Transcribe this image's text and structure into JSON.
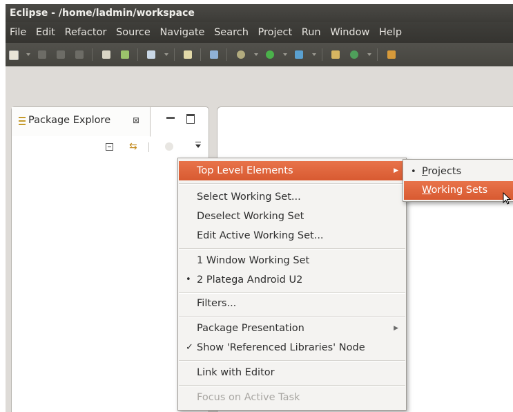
{
  "window": {
    "title": "Eclipse - /home/ladmin/workspace"
  },
  "menubar": {
    "items": [
      "File",
      "Edit",
      "Refactor",
      "Source",
      "Navigate",
      "Search",
      "Project",
      "Run",
      "Window",
      "Help"
    ]
  },
  "package_explorer": {
    "tab_label": "Package Explore",
    "close_glyph": "⊠"
  },
  "context_menu": {
    "top_level_elements": "Top Level Elements",
    "select_working_set": "Select Working Set...",
    "deselect_working_set": "Deselect Working Set",
    "edit_active_working_set": "Edit Active Working Set...",
    "recent_1": "1 Window Working Set",
    "recent_2": "2 Platega Android U2",
    "recent_2_marker": "•",
    "filters": "Filters...",
    "package_presentation": "Package Presentation",
    "show_referenced_libraries": "Show 'Referenced Libraries' Node",
    "show_referenced_libraries_check": "✓",
    "link_with_editor": "Link with Editor",
    "focus_on_active_task": "Focus on Active Task"
  },
  "submenu": {
    "projects_marker": "•",
    "projects_mnemonic": "P",
    "projects_rest": "rojects",
    "working_sets_mnemonic": "W",
    "working_sets_rest": "orking Sets"
  },
  "colors": {
    "highlight": "#dd6336",
    "title_bar": "#3c3b37"
  }
}
